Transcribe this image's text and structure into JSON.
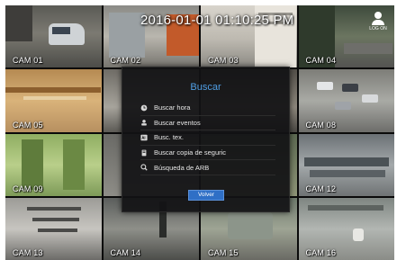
{
  "timestamp": "2016-01-01 01:10:25 PM",
  "user_badge": {
    "icon": "user-icon",
    "label": "LOG ON"
  },
  "cameras": [
    {
      "label": "CAM 01"
    },
    {
      "label": "CAM 02"
    },
    {
      "label": "CAM 03"
    },
    {
      "label": "CAM 04"
    },
    {
      "label": "CAM 05"
    },
    {
      "label": ""
    },
    {
      "label": ""
    },
    {
      "label": "CAM 08"
    },
    {
      "label": "CAM 09"
    },
    {
      "label": ""
    },
    {
      "label": ""
    },
    {
      "label": "CAM 12"
    },
    {
      "label": "CAM 13"
    },
    {
      "label": "CAM 14"
    },
    {
      "label": "CAM 15"
    },
    {
      "label": "CAM 16"
    }
  ],
  "search_dialog": {
    "title": "Buscar",
    "items": [
      {
        "label": "Buscar hora",
        "icon": "clock-icon"
      },
      {
        "label": "Buscar eventos",
        "icon": "event-icon"
      },
      {
        "label": "Busc. tex.",
        "icon": "text-icon"
      },
      {
        "label": "Buscar copia de seguric",
        "icon": "backup-icon"
      },
      {
        "label": "Búsqueda de ARB",
        "icon": "arb-icon"
      }
    ],
    "back_label": "Volver"
  }
}
